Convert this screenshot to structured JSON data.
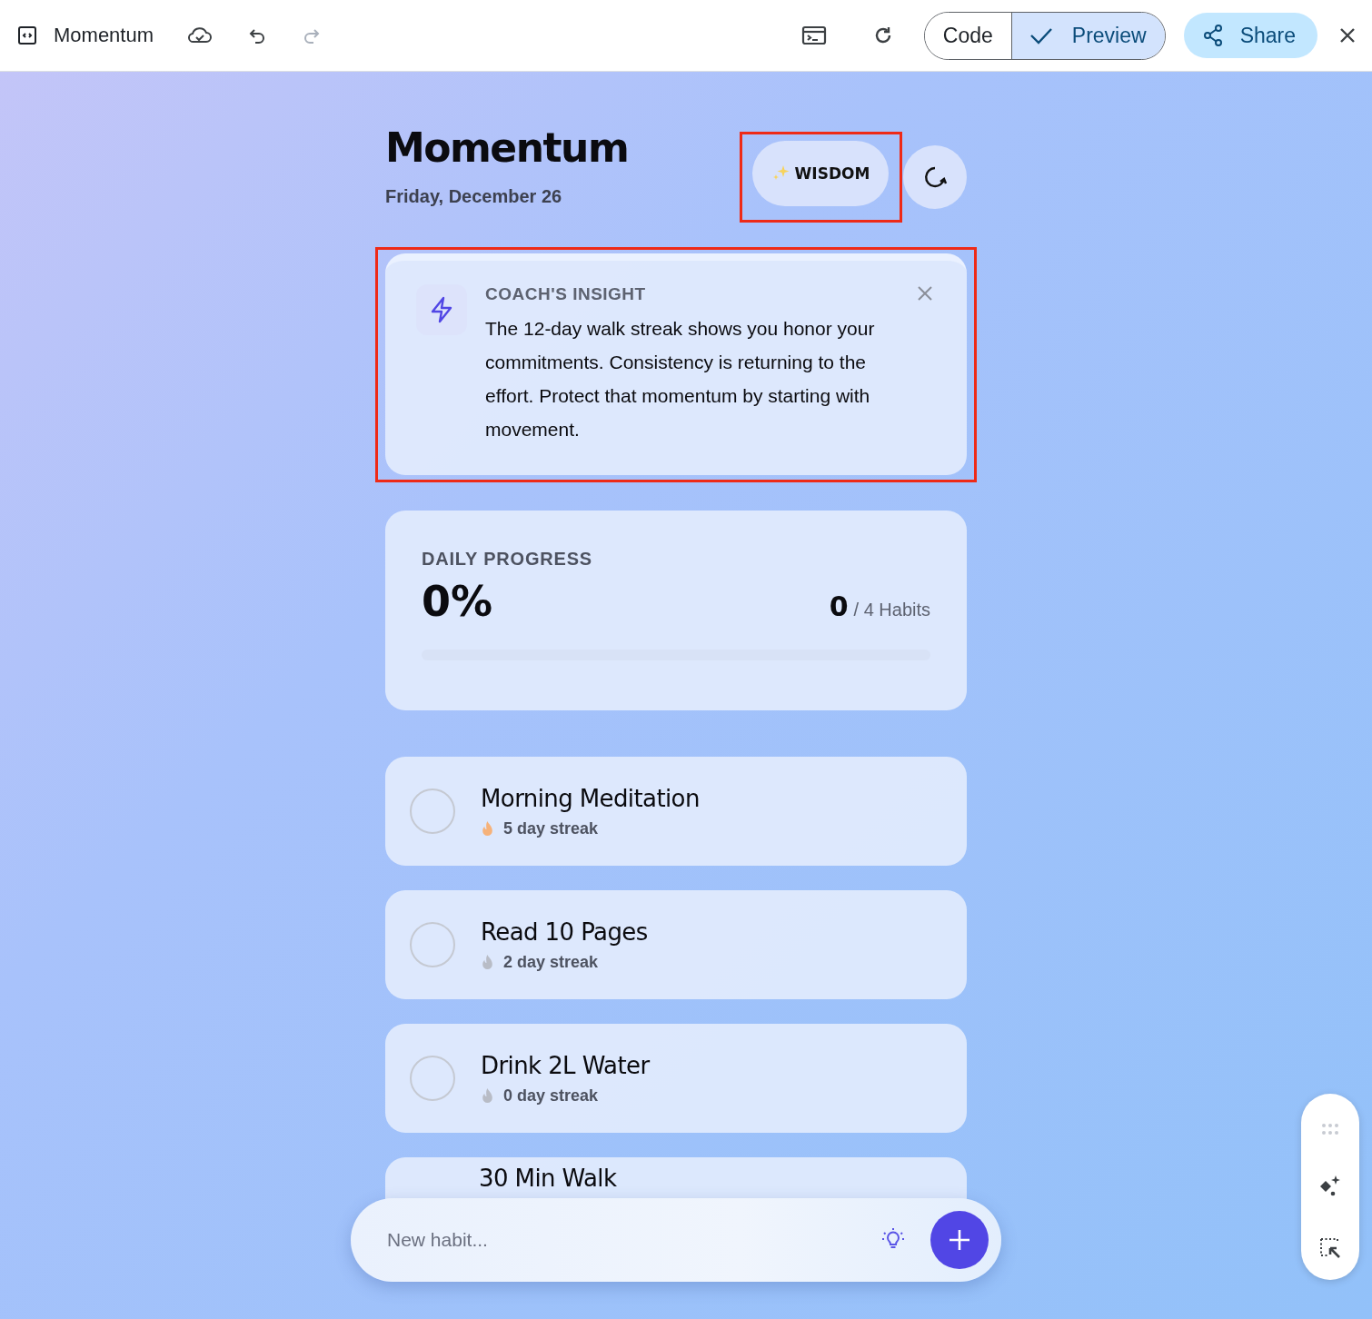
{
  "toolbar": {
    "title": "Momentum",
    "redo_disabled": true,
    "view_toggle": [
      {
        "label": "Code",
        "selected": false
      },
      {
        "label": "Preview",
        "selected": true
      }
    ],
    "share": "Share"
  },
  "header": {
    "title": "Momentum",
    "date": "Friday, December 26",
    "wisdom": {
      "label": "WISDOM",
      "highlighted": true
    }
  },
  "insight": {
    "label": "COACH'S INSIGHT",
    "text": "The 12-day walk streak shows you honor your commitments. Consistency is returning to the effort. Protect that momentum by starting with movement.",
    "highlighted": true
  },
  "progress": {
    "label": "DAILY PROGRESS",
    "percent": "0%",
    "done": "0",
    "total": "/ 4 Habits",
    "level": 0
  },
  "habits": [
    {
      "name": "Morning Meditation",
      "streak": "5 day streak",
      "checked": false,
      "color": "#f6b27a"
    },
    {
      "name": "Read 10 Pages",
      "streak": "2 day streak",
      "checked": false,
      "color": "#b8bcc6"
    },
    {
      "name": "Drink 2L Water",
      "streak": "0 day streak",
      "checked": false,
      "color": "#b8bcc6"
    },
    {
      "name": "30 Min Walk"
    }
  ],
  "new_habit": {
    "placeholder": "New habit..."
  }
}
